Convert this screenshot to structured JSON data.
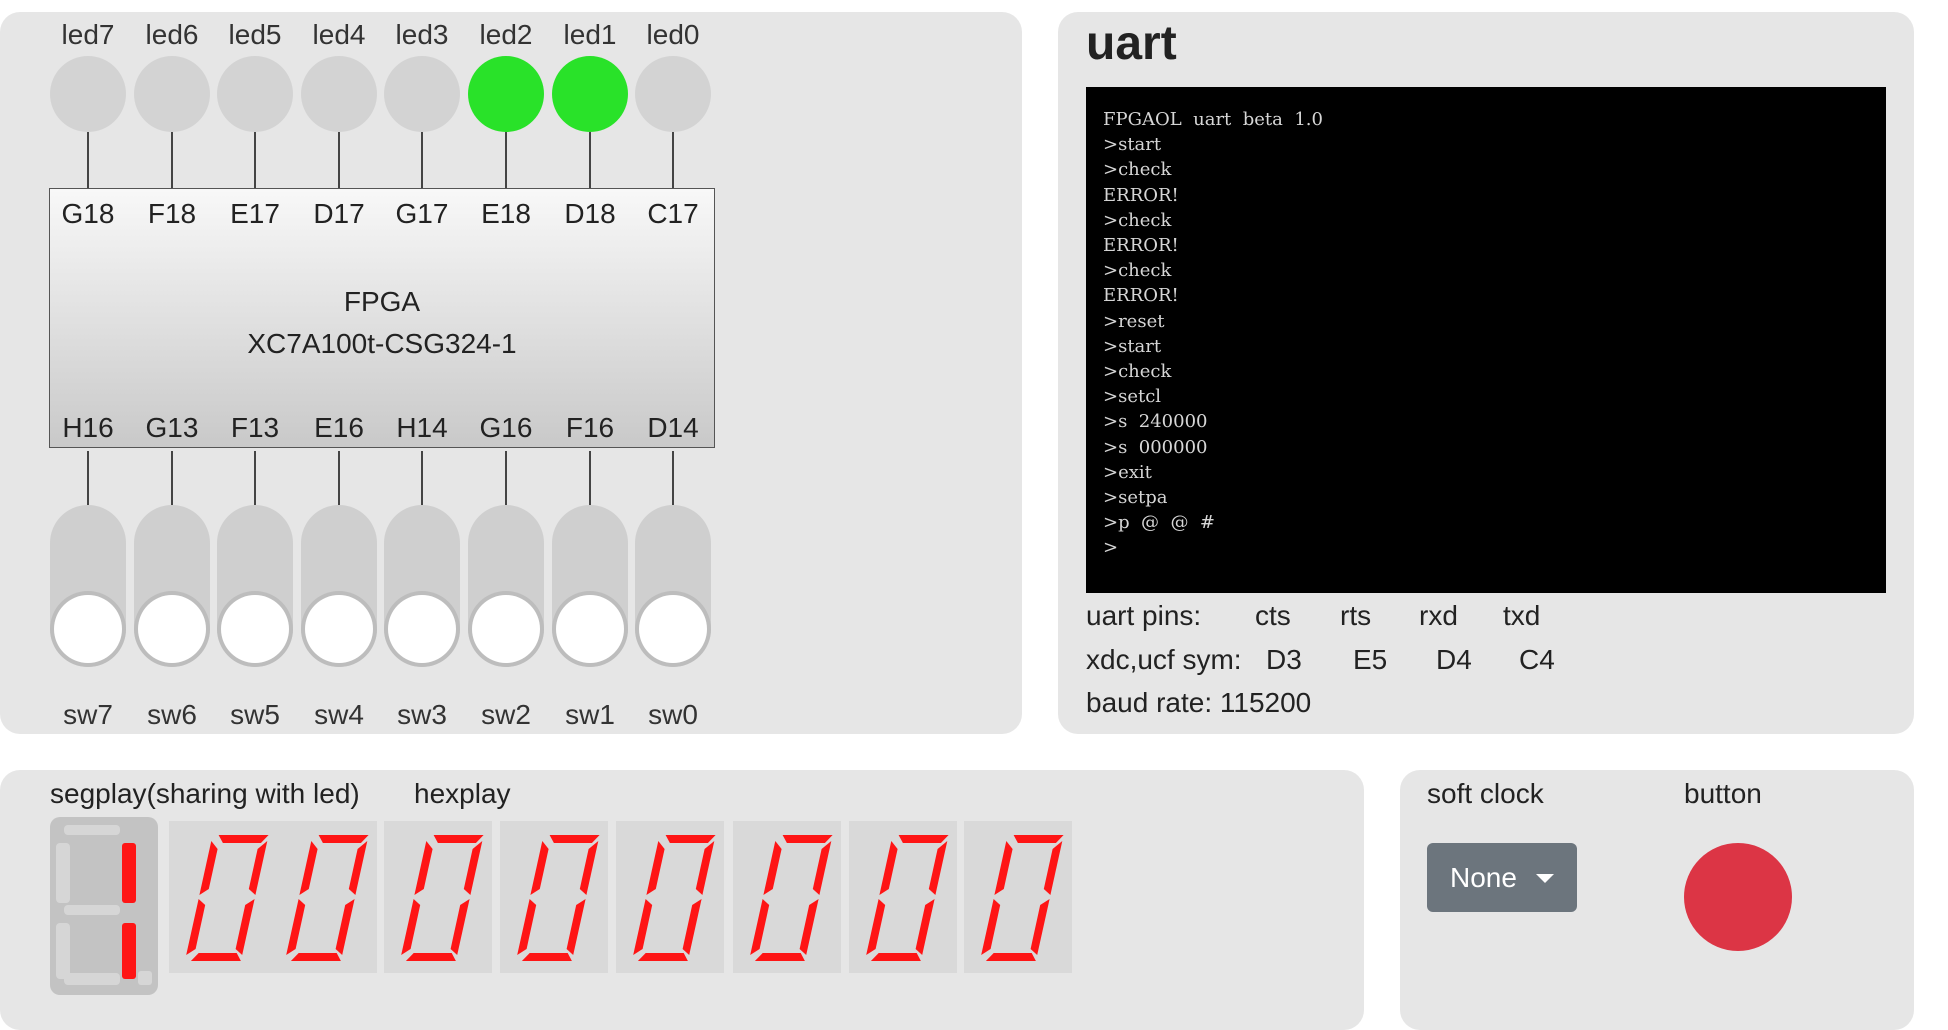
{
  "leds": [
    {
      "label": "led7",
      "on": false
    },
    {
      "label": "led6",
      "on": false
    },
    {
      "label": "led5",
      "on": false
    },
    {
      "label": "led4",
      "on": false
    },
    {
      "label": "led3",
      "on": false
    },
    {
      "label": "led2",
      "on": true
    },
    {
      "label": "led1",
      "on": true
    },
    {
      "label": "led0",
      "on": false
    }
  ],
  "colors": {
    "led_on": "#29e229",
    "led_off": "#d3d3d3",
    "segment_on": "#fe1515",
    "button": "#dc3545",
    "clock_button": "#6c757d"
  },
  "fpga": {
    "name": "FPGA",
    "part": "XC7A100t-CSG324-1",
    "top_pins": [
      "G18",
      "F18",
      "E17",
      "D17",
      "G17",
      "E18",
      "D18",
      "C17"
    ],
    "bottom_pins": [
      "H16",
      "G13",
      "F13",
      "E16",
      "H14",
      "G16",
      "F16",
      "D14"
    ]
  },
  "switches": [
    {
      "label": "sw7",
      "state": "off"
    },
    {
      "label": "sw6",
      "state": "off"
    },
    {
      "label": "sw5",
      "state": "off"
    },
    {
      "label": "sw4",
      "state": "off"
    },
    {
      "label": "sw3",
      "state": "off"
    },
    {
      "label": "sw2",
      "state": "off"
    },
    {
      "label": "sw1",
      "state": "off"
    },
    {
      "label": "sw0",
      "state": "off"
    }
  ],
  "uart": {
    "title": "uart",
    "terminal_lines": [
      "FPGAOL  uart  beta  1.0",
      ">start",
      ">check",
      "ERROR!",
      ">check",
      "ERROR!",
      ">check",
      "ERROR!",
      ">reset",
      ">start",
      ">check",
      ">setcl",
      ">s  240000",
      ">s  000000",
      ">exit",
      ">setpa",
      ">p  @  @  #",
      ">"
    ],
    "pins_label": "uart pins:",
    "pins": [
      "cts",
      "rts",
      "rxd",
      "txd"
    ],
    "sym_label": "xdc,ucf sym:",
    "syms": [
      "D3",
      "E5",
      "D4",
      "C4"
    ],
    "baud_label": "baud rate:",
    "baud_value": "115200"
  },
  "segplay": {
    "title": "segplay(sharing with led)",
    "big_digit_segments_on": [
      "b",
      "c"
    ]
  },
  "hexplay": {
    "title": "hexplay",
    "digits": [
      "0",
      "0",
      "0",
      "0",
      "0",
      "0",
      "0",
      "0"
    ]
  },
  "soft_clock": {
    "title": "soft clock",
    "selected": "None"
  },
  "button": {
    "title": "button"
  }
}
